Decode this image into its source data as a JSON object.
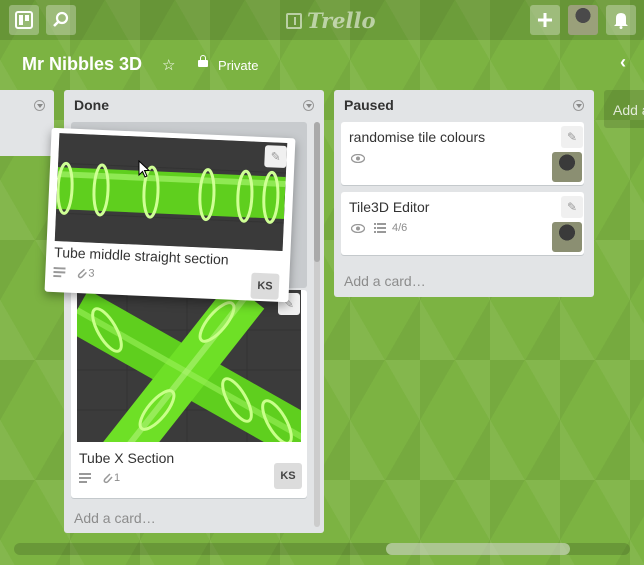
{
  "header": {
    "logo_text": "Trello",
    "icons": {
      "boards": "boards-icon",
      "search": "search-icon",
      "add": "plus-icon",
      "notifications": "bell-icon"
    }
  },
  "board": {
    "title": "Mr Nibbles 3D",
    "visibility": "Private",
    "star_glyph": "☆",
    "collapse_glyph": "‹"
  },
  "lists": [
    {
      "title": "Done",
      "add_card": "Add a card…",
      "cards": [
        {
          "title": "Tube middle straight section",
          "attachments": "3",
          "member": "KS",
          "dragging": true
        },
        {
          "title": "Tube X Section",
          "attachments": "1",
          "member": "KS"
        }
      ]
    },
    {
      "title": "Paused",
      "add_card": "Add a card…",
      "cards": [
        {
          "title": "randomise tile colours",
          "watching": true
        },
        {
          "title": "Tile3D Editor",
          "watching": true,
          "checklist": "4/6"
        }
      ]
    }
  ],
  "add_list_label": "Add a",
  "colors": {
    "board_bg": "#7cb342",
    "list_bg": "#e2e4e6",
    "tube": "#66e020"
  }
}
